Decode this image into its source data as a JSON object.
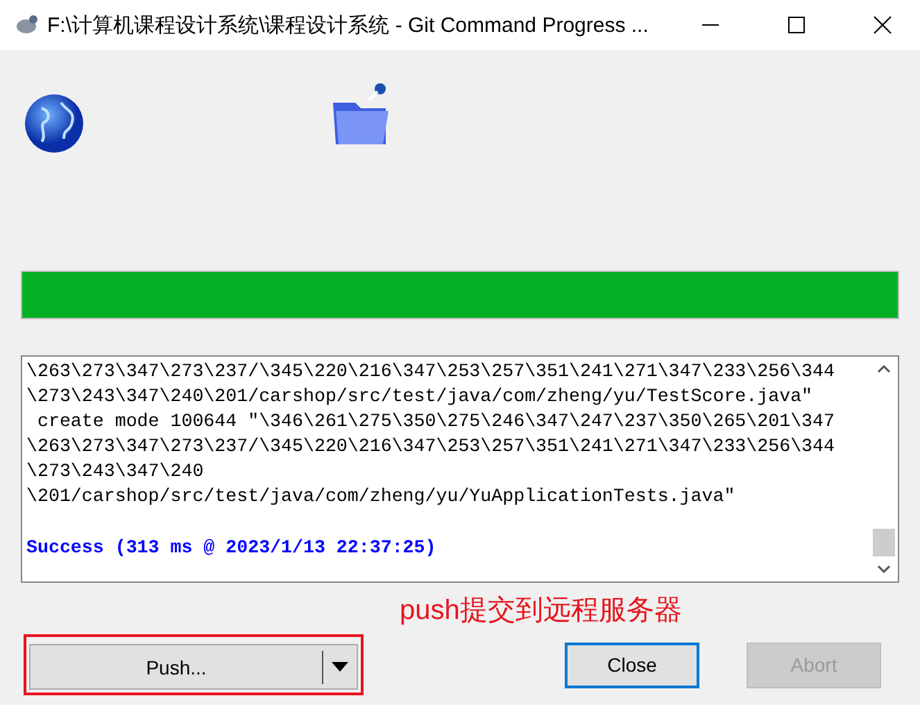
{
  "window": {
    "title": "F:\\计算机课程设计系统\\课程设计系统 - Git Command Progress ..."
  },
  "progress": {
    "level": 1
  },
  "log": {
    "lines": [
      {
        "kind": "plain",
        "text": "\\263\\273\\347\\273\\237/\\345\\220\\216\\347\\253\\257\\351\\241\\271\\347\\233\\256\\344"
      },
      {
        "kind": "plain",
        "text": "\\273\\243\\347\\240\\201/carshop/src/test/java/com/zheng/yu/TestScore.java\""
      },
      {
        "kind": "plain",
        "text": " create mode 100644 \"\\346\\261\\275\\350\\275\\246\\347\\247\\237\\350\\265\\201\\347"
      },
      {
        "kind": "plain",
        "text": "\\263\\273\\347\\273\\237/\\345\\220\\216\\347\\253\\257\\351\\241\\271\\347\\233\\256\\344"
      },
      {
        "kind": "plain",
        "text": "\\273\\243\\347\\240"
      },
      {
        "kind": "plain",
        "text": "\\201/carshop/src/test/java/com/zheng/yu/YuApplicationTests.java\""
      },
      {
        "kind": "success",
        "text": "Success (313 ms @ 2023/1/13 22:37:25)"
      }
    ]
  },
  "annotation": {
    "text": "push提交到远程服务器"
  },
  "buttons": [
    {
      "kind": "split",
      "label": "Push...",
      "focused": false,
      "disabled": false
    },
    {
      "kind": "plain",
      "label": "Close",
      "focused": true,
      "disabled": false
    },
    {
      "kind": "plain",
      "label": "Abort",
      "focused": false,
      "disabled": true
    }
  ]
}
